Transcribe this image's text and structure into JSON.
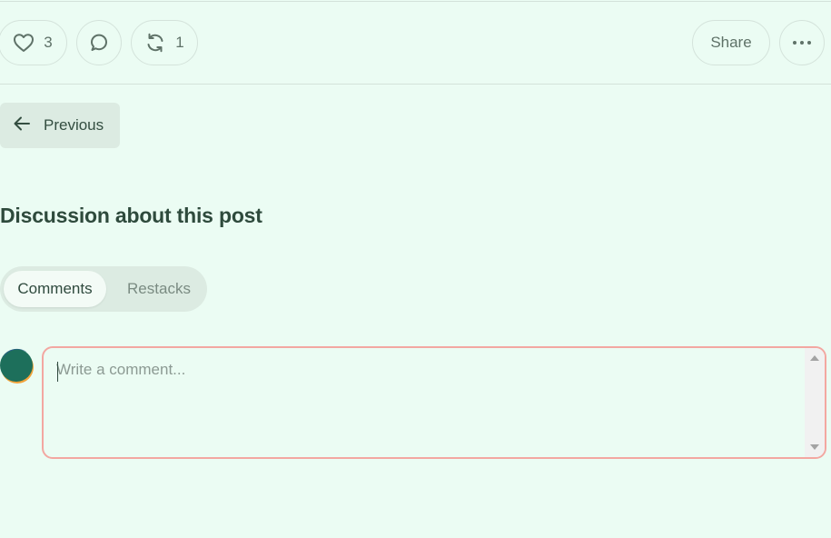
{
  "actions": {
    "like_count": "3",
    "restack_count": "1",
    "share_label": "Share"
  },
  "nav": {
    "previous_label": "Previous"
  },
  "discussion": {
    "heading": "Discussion about this post",
    "tabs": [
      {
        "label": "Comments",
        "active": true
      },
      {
        "label": "Restacks",
        "active": false
      }
    ]
  },
  "comment": {
    "placeholder": "Write a comment...",
    "value": ""
  },
  "icons": {
    "like": "heart-icon",
    "comment": "comment-bubble-icon",
    "restack": "restack-icon",
    "more": "more-horizontal-icon",
    "previous": "arrow-left-icon"
  },
  "colors": {
    "background": "#ebfcf3",
    "text": "#2f4a3e",
    "input_border": "#f3a7a1",
    "secondary_bg": "#dcebe2"
  }
}
